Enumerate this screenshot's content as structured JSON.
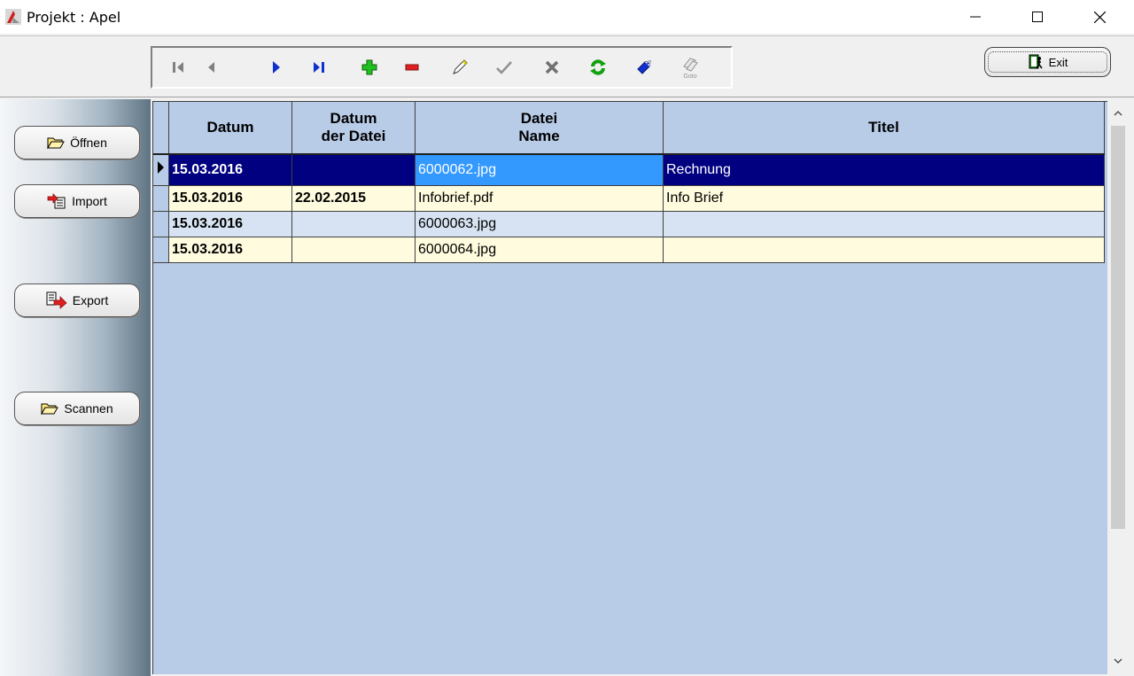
{
  "window": {
    "title": "Projekt : Apel"
  },
  "toolbar": {
    "nav_buttons": [
      "first-record",
      "prior-record",
      "next-record",
      "last-record",
      "insert-record",
      "delete-record",
      "edit-record",
      "post-edit",
      "cancel-edit",
      "refresh-data",
      "apply-updates",
      "goto-record"
    ],
    "goto_label": "Goto",
    "exit_label": "Exit"
  },
  "sidebar": {
    "open_label": "Öffnen",
    "import_label": "Import",
    "export_label": "Export",
    "scan_label": "Scannen"
  },
  "table": {
    "columns": [
      {
        "line1": "Datum",
        "line2": ""
      },
      {
        "line1": "Datum",
        "line2": "der Datei"
      },
      {
        "line1": "Datei",
        "line2": "Name"
      },
      {
        "line1": "Titel",
        "line2": ""
      }
    ],
    "rows": [
      {
        "datum": "15.03.2016",
        "datum_datei": "",
        "name": "6000062.jpg",
        "titel": "Rechnung"
      },
      {
        "datum": "15.03.2016",
        "datum_datei": "22.02.2015",
        "name": "Infobrief.pdf",
        "titel": "Info Brief"
      },
      {
        "datum": "15.03.2016",
        "datum_datei": "",
        "name": "6000063.jpg",
        "titel": ""
      },
      {
        "datum": "15.03.2016",
        "datum_datei": "",
        "name": "6000064.jpg",
        "titel": ""
      }
    ],
    "selected_row": 0
  },
  "colors": {
    "grid_background": "#b8cce8",
    "selected_row": "#000080",
    "selected_cell": "#3399ff",
    "row_cream": "#fefbde",
    "row_blue": "#d7e3f2"
  }
}
